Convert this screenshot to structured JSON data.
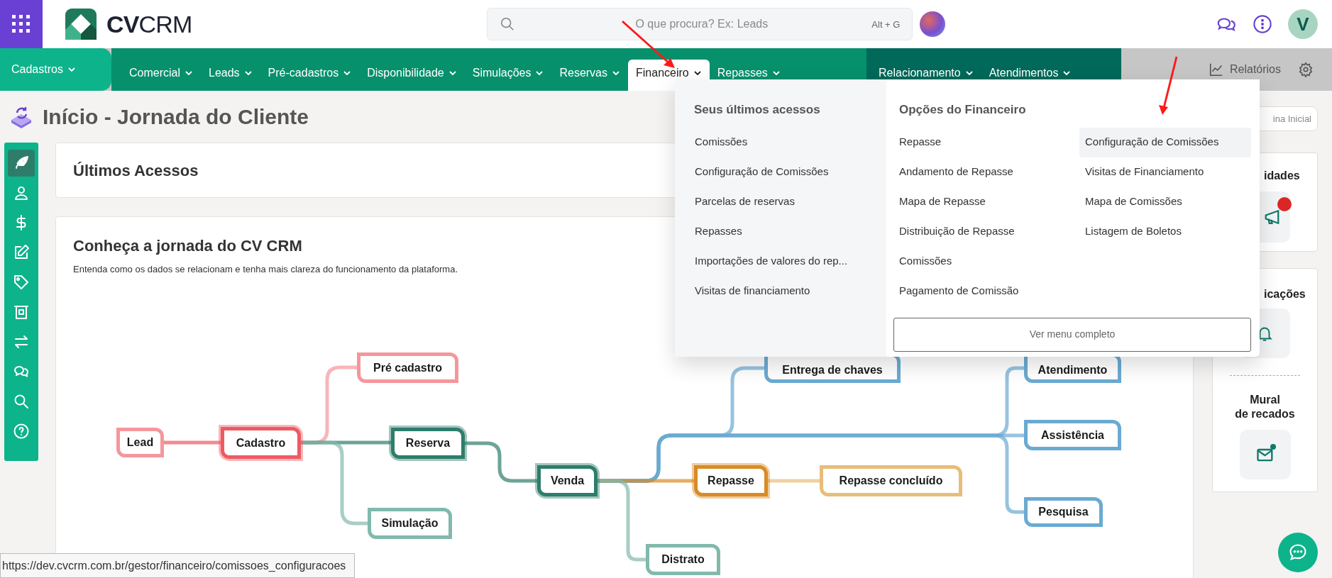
{
  "header": {
    "logo": "**CV**CRM",
    "search": {
      "placeholder": "O que procura? Ex: Leads",
      "shortcut": "Alt + G"
    },
    "user_initial": "V"
  },
  "nav": {
    "groups": [
      {
        "items": [
          {
            "label": "Cadastros",
            "selected": false
          }
        ]
      },
      {
        "items": [
          {
            "label": "Comercial",
            "selected": false
          },
          {
            "label": "Leads",
            "selected": false
          },
          {
            "label": "Pré-cadastros",
            "selected": false
          },
          {
            "label": "Disponibilidade",
            "selected": false
          },
          {
            "label": "Simulações",
            "selected": false
          },
          {
            "label": "Reservas",
            "selected": false
          },
          {
            "label": "Financeiro",
            "selected": true
          },
          {
            "label": "Repasses",
            "selected": false
          }
        ]
      },
      {
        "items": [
          {
            "label": "Relacionamento",
            "selected": false
          },
          {
            "label": "Atendimentos",
            "selected": false
          }
        ]
      }
    ],
    "reports": "Relatórios"
  },
  "dropdown": {
    "recent_title": "Seus últimos acessos",
    "recent": [
      "Comissões",
      "Configuração de Comissões",
      "Parcelas de reservas",
      "Repasses",
      "Importações de valores do rep...",
      "Visitas de financiamento"
    ],
    "options_title": "Opções do Financeiro",
    "options": [
      {
        "label": "Repasse",
        "hovered": false
      },
      {
        "label": "Andamento de Repasse",
        "hovered": false
      },
      {
        "label": "Mapa de Repasse",
        "hovered": false
      },
      {
        "label": "Distribuição de Repasse",
        "hovered": false
      },
      {
        "label": "Comissões",
        "hovered": false
      },
      {
        "label": "Pagamento de Comissão",
        "hovered": false
      },
      {
        "label": "Configuração de Comissões",
        "hovered": true
      },
      {
        "label": "Visitas de Financiamento",
        "hovered": false
      },
      {
        "label": "Mapa de Comissões",
        "hovered": false
      },
      {
        "label": "Listagem de Boletos",
        "hovered": false
      }
    ],
    "full_menu_button": "Ver menu completo"
  },
  "page_title": "Início - Jornada do Cliente",
  "tools": [
    {
      "selected": true
    },
    {
      "selected": false
    },
    {
      "selected": false
    },
    {
      "selected": false
    },
    {
      "selected": false
    },
    {
      "selected": false
    },
    {
      "selected": false
    },
    {
      "selected": false
    },
    {
      "selected": false
    },
    {
      "selected": false
    }
  ],
  "recent_card": {
    "title": "Últimos Acessos"
  },
  "journey": {
    "title": "Conheça a jornada do CV CRM",
    "subtitle": "Entenda como os dados se relacionam e tenha mais clareza do funcionamento da plataforma.",
    "nodes": [
      {
        "label": "Lead",
        "color": "#f4979c",
        "highlighted": false,
        "children": [
          {
            "label": "Cadastro",
            "color": "#ee5a62",
            "highlighted": true,
            "children": [
              {
                "label": "Pré cadastro",
                "color": "#f4979c",
                "highlighted": false
              },
              {
                "label": "Reserva",
                "color": "#2e7d6b",
                "highlighted": true,
                "children": [
                  {
                    "label": "Venda",
                    "color": "#2e7d6b",
                    "highlighted": true,
                    "children": [
                      {
                        "label": "Entrega de chaves",
                        "color": "#6aaad2",
                        "highlighted": false
                      },
                      {
                        "label": "Atendimento",
                        "color": "#6aaad2",
                        "highlighted": false
                      },
                      {
                        "label": "Assistência",
                        "color": "#6aaad2",
                        "highlighted": false
                      },
                      {
                        "label": "Pesquisa",
                        "color": "#6aaad2",
                        "highlighted": false
                      },
                      {
                        "label": "Repasse",
                        "color": "#d98b25",
                        "highlighted": true,
                        "children": [
                          {
                            "label": "Repasse concluído",
                            "color": "#e8bd7a",
                            "highlighted": false
                          }
                        ]
                      },
                      {
                        "label": "Distrato",
                        "color": "#82b9ac",
                        "highlighted": false
                      }
                    ]
                  }
                ]
              },
              {
                "label": "Simulação",
                "color": "#82b9ac",
                "highlighted": false
              }
            ]
          }
        ]
      }
    ]
  },
  "right_panel": {
    "home_button": "ina Inicial",
    "news": {
      "title": "idades",
      "unread": true
    },
    "notifications": {
      "title": "icações"
    },
    "wall": {
      "title": "Mural\nde recados",
      "unread": true
    }
  },
  "status_url": "https://dev.cvcrm.com.br/gestor/financeiro/comissoes_configuracoes"
}
